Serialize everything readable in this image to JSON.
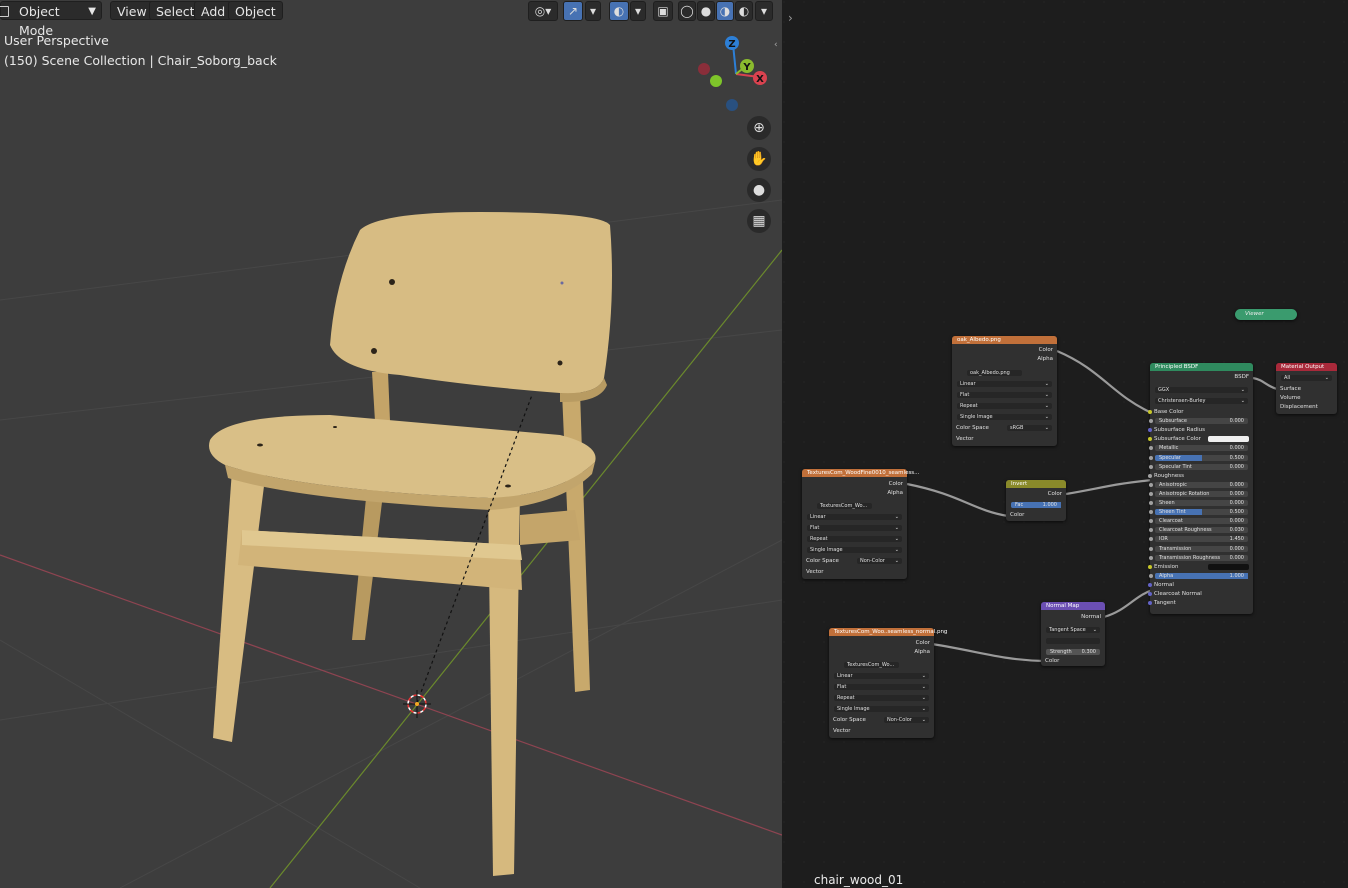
{
  "viewport": {
    "header": {
      "mode": "Object Mode",
      "menus": [
        "View",
        "Select",
        "Add",
        "Object"
      ]
    },
    "overlay": {
      "view_name": "User Perspective",
      "collection": "(150) Scene Collection | Chair_Soborg_back"
    },
    "gizmo": {
      "z": "Z",
      "y": "Y",
      "x": "X"
    },
    "colors": {
      "bg": "#3d3d3d",
      "grid": "#4a4a4a",
      "x_axis": "#a44a56",
      "y_axis": "#6f8f2e",
      "wood": "#d4b67a"
    }
  },
  "node_editor": {
    "material_name": "chair_wood_01",
    "viewer": {
      "title": "Viewer"
    },
    "albedo_node": {
      "title": "oak_Albedo.png",
      "outputs": [
        "Color",
        "Alpha"
      ],
      "image": "oak_Albedo.png",
      "fields": [
        "Linear",
        "Flat",
        "Repeat",
        "Single Image"
      ],
      "color_space_label": "Color Space",
      "color_space": "sRGB",
      "vector": "Vector"
    },
    "wood_node": {
      "title": "TexturesCom_WoodFine0010_seamless...",
      "outputs": [
        "Color",
        "Alpha"
      ],
      "image": "TexturesCom_Wo...",
      "fields": [
        "Linear",
        "Flat",
        "Repeat",
        "Single Image"
      ],
      "color_space_label": "Color Space",
      "color_space": "Non-Color",
      "vector": "Vector"
    },
    "normal_tex_node": {
      "title": "TexturesCom_Woo..seamless_normal.png",
      "outputs": [
        "Color",
        "Alpha"
      ],
      "image": "TexturesCom_Wo...",
      "fields": [
        "Linear",
        "Flat",
        "Repeat",
        "Single Image"
      ],
      "color_space_label": "Color Space",
      "color_space": "Non-Color",
      "vector": "Vector"
    },
    "invert_node": {
      "title": "Invert",
      "output": "Color",
      "fac_label": "Fac",
      "fac": "1.000",
      "input": "Color"
    },
    "normal_map_node": {
      "title": "Normal Map",
      "output": "Normal",
      "space": "Tangent Space",
      "strength_label": "Strength",
      "strength": "0.300",
      "input": "Color"
    },
    "bsdf_node": {
      "title": "Principled BSDF",
      "output": "BSDF",
      "dist": "GGX",
      "sss_method": "Christensen-Burley",
      "rows": [
        {
          "label": "Base Color",
          "value": ""
        },
        {
          "label": "Subsurface",
          "value": "0.000"
        },
        {
          "label": "Subsurface Radius",
          "value": ""
        },
        {
          "label": "Subsurface Color",
          "value": ""
        },
        {
          "label": "Metallic",
          "value": "0.000"
        },
        {
          "label": "Specular",
          "value": "0.500"
        },
        {
          "label": "Specular Tint",
          "value": "0.000"
        },
        {
          "label": "Roughness",
          "value": ""
        },
        {
          "label": "Anisotropic",
          "value": "0.000"
        },
        {
          "label": "Anisotropic Rotation",
          "value": "0.000"
        },
        {
          "label": "Sheen",
          "value": "0.000"
        },
        {
          "label": "Sheen Tint",
          "value": "0.500"
        },
        {
          "label": "Clearcoat",
          "value": "0.000"
        },
        {
          "label": "Clearcoat Roughness",
          "value": "0.030"
        },
        {
          "label": "IOR",
          "value": "1.450"
        },
        {
          "label": "Transmission",
          "value": "0.000"
        },
        {
          "label": "Transmission Roughness",
          "value": "0.000"
        },
        {
          "label": "Emission",
          "value": ""
        },
        {
          "label": "Alpha",
          "value": "1.000"
        },
        {
          "label": "Normal",
          "value": ""
        },
        {
          "label": "Clearcoat Normal",
          "value": ""
        },
        {
          "label": "Tangent",
          "value": ""
        }
      ]
    },
    "output_node": {
      "title": "Material Output",
      "target": "All",
      "inputs": [
        "Surface",
        "Volume",
        "Displacement"
      ]
    }
  }
}
